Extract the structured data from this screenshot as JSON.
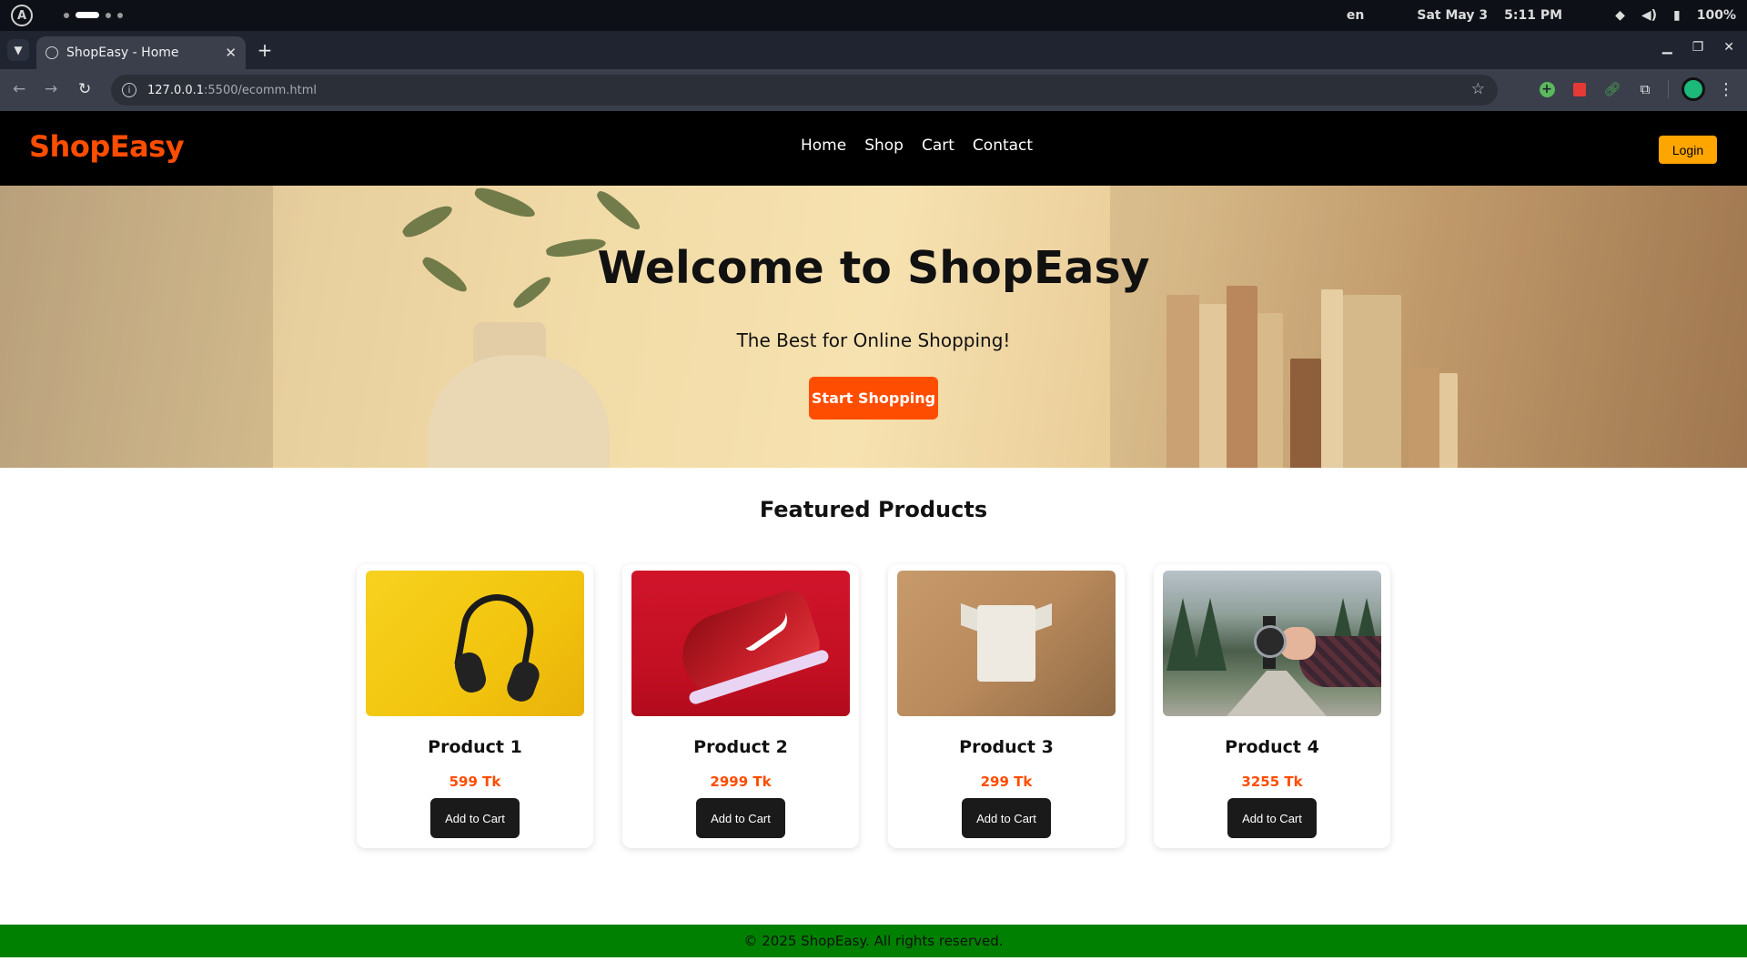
{
  "os": {
    "workspaces": 4,
    "active_workspace": 2,
    "language": "en",
    "date": "Sat May 3",
    "time": "5:11 PM",
    "battery": "100%",
    "icons": [
      "launcher-icon",
      "wifi-icon",
      "volume-icon",
      "battery-icon"
    ]
  },
  "browser": {
    "tab_title": "ShopEasy - Home",
    "url_host": "127.0.0.1",
    "url_rest": ":5500/ecomm.html",
    "window_controls": [
      "minimize-icon",
      "restore-icon",
      "close-icon"
    ]
  },
  "site": {
    "brand": "ShopEasy",
    "nav": [
      "Home",
      "Shop",
      "Cart",
      "Contact"
    ],
    "login_label": "Login",
    "hero": {
      "title": "Welcome to ShopEasy",
      "subtitle": "The Best for Online Shopping!",
      "cta": "Start Shopping"
    },
    "featured_title": "Featured Products",
    "products": [
      {
        "name": "Product 1",
        "price": "599 Tk",
        "button": "Add to Cart",
        "image": "headphones"
      },
      {
        "name": "Product 2",
        "price": "2999 Tk",
        "button": "Add to Cart",
        "image": "sneaker"
      },
      {
        "name": "Product 3",
        "price": "299 Tk",
        "button": "Add to Cart",
        "image": "t-shirt"
      },
      {
        "name": "Product 4",
        "price": "3255 Tk",
        "button": "Add to Cart",
        "image": "wristwatch"
      }
    ],
    "footer": "© 2025 ShopEasy. All rights reserved.",
    "colors": {
      "brand": "#ff4d00",
      "header_bg": "#000000",
      "login_bg": "#ffa500",
      "footer_bg": "#008000",
      "button_dark": "#1a1a1a"
    }
  }
}
